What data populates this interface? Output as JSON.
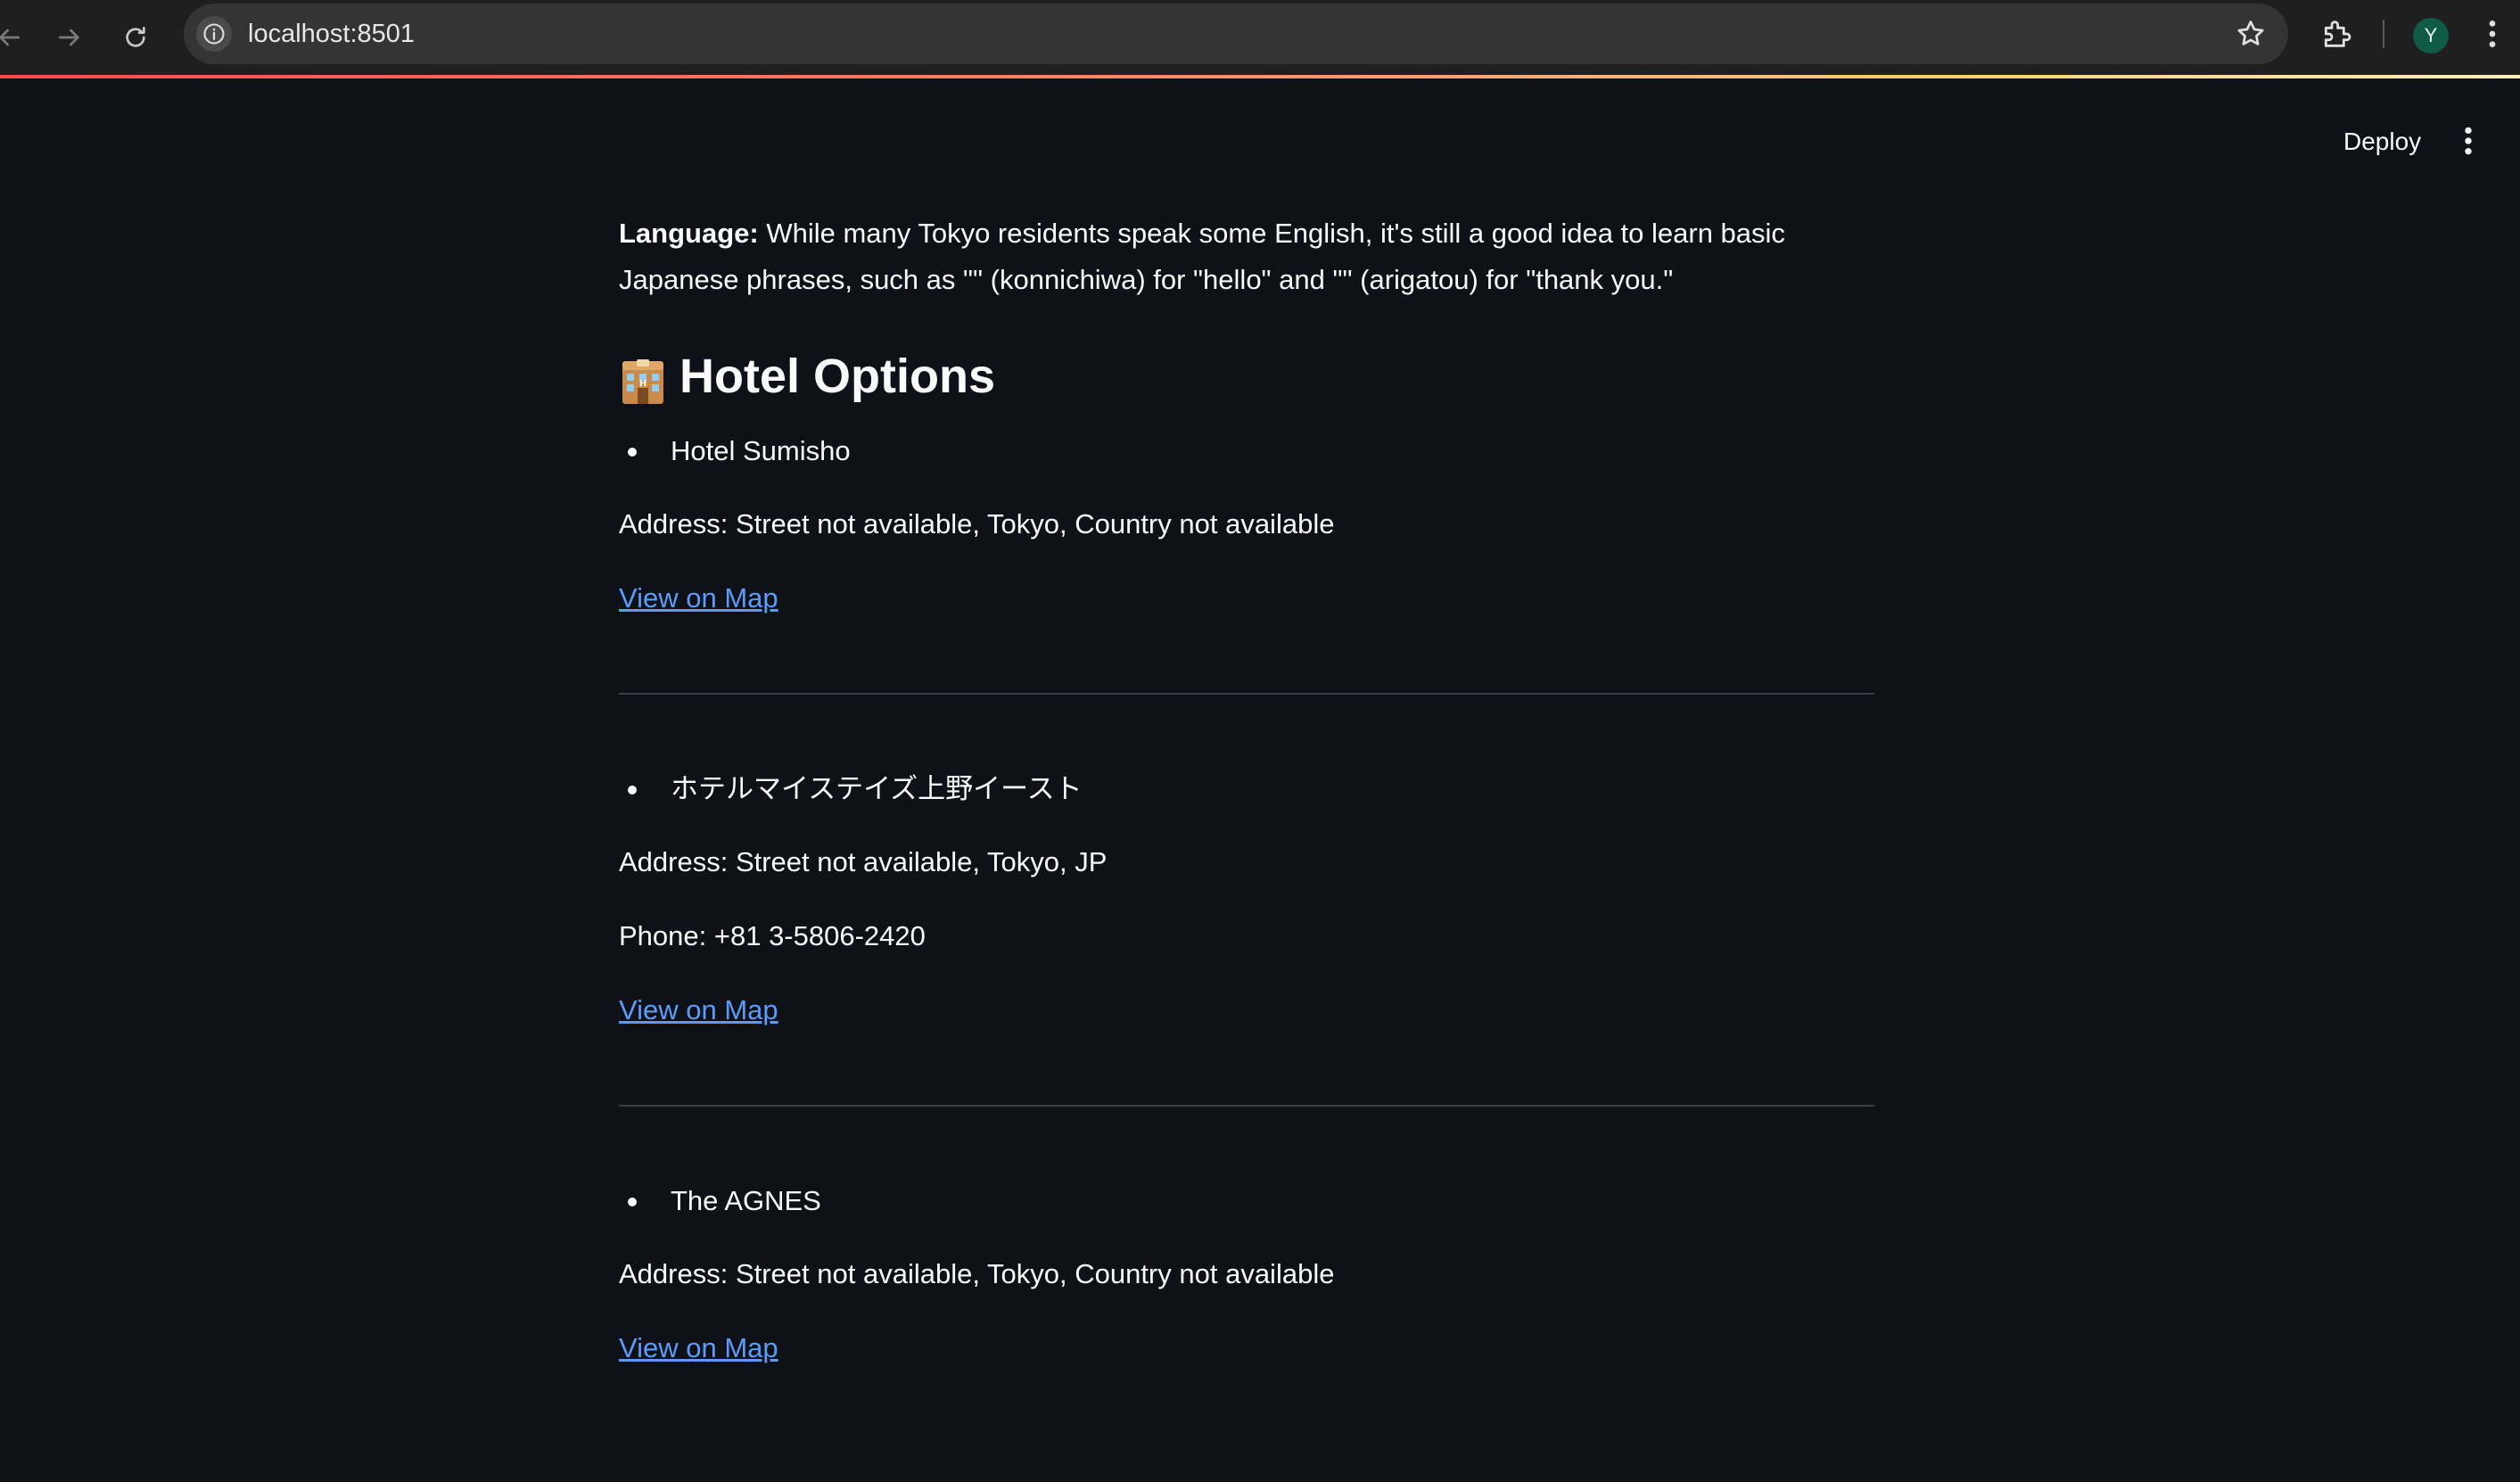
{
  "browser": {
    "url": "localhost:8501",
    "avatar_letter": "Y"
  },
  "header": {
    "deploy_label": "Deploy"
  },
  "intro": {
    "language_label": "Language:",
    "language_text": " While many Tokyo residents speak some English, it's still a good idea to learn basic Japanese phrases, such as \"\" (konnichiwa) for \"hello\" and \"\" (arigatou) for \"thank you.\""
  },
  "section": {
    "title": "Hotel Options",
    "icon": "hotel-emoji"
  },
  "hotels": [
    {
      "name": "Hotel Sumisho",
      "address": "Address: Street not available, Tokyo, Country not available",
      "phone": "",
      "map_label": "View on Map"
    },
    {
      "name": "ホテルマイステイズ上野イースト",
      "address": "Address: Street not available, Tokyo, JP",
      "phone": "Phone: +81 3-5806-2420",
      "map_label": "View on Map"
    },
    {
      "name": "The AGNES",
      "address": "Address: Street not available, Tokyo, Country not available",
      "phone": "",
      "map_label": "View on Map"
    }
  ],
  "colors": {
    "background": "#0e1117",
    "link": "#5a9cf8",
    "divider": "#3a3d45"
  }
}
